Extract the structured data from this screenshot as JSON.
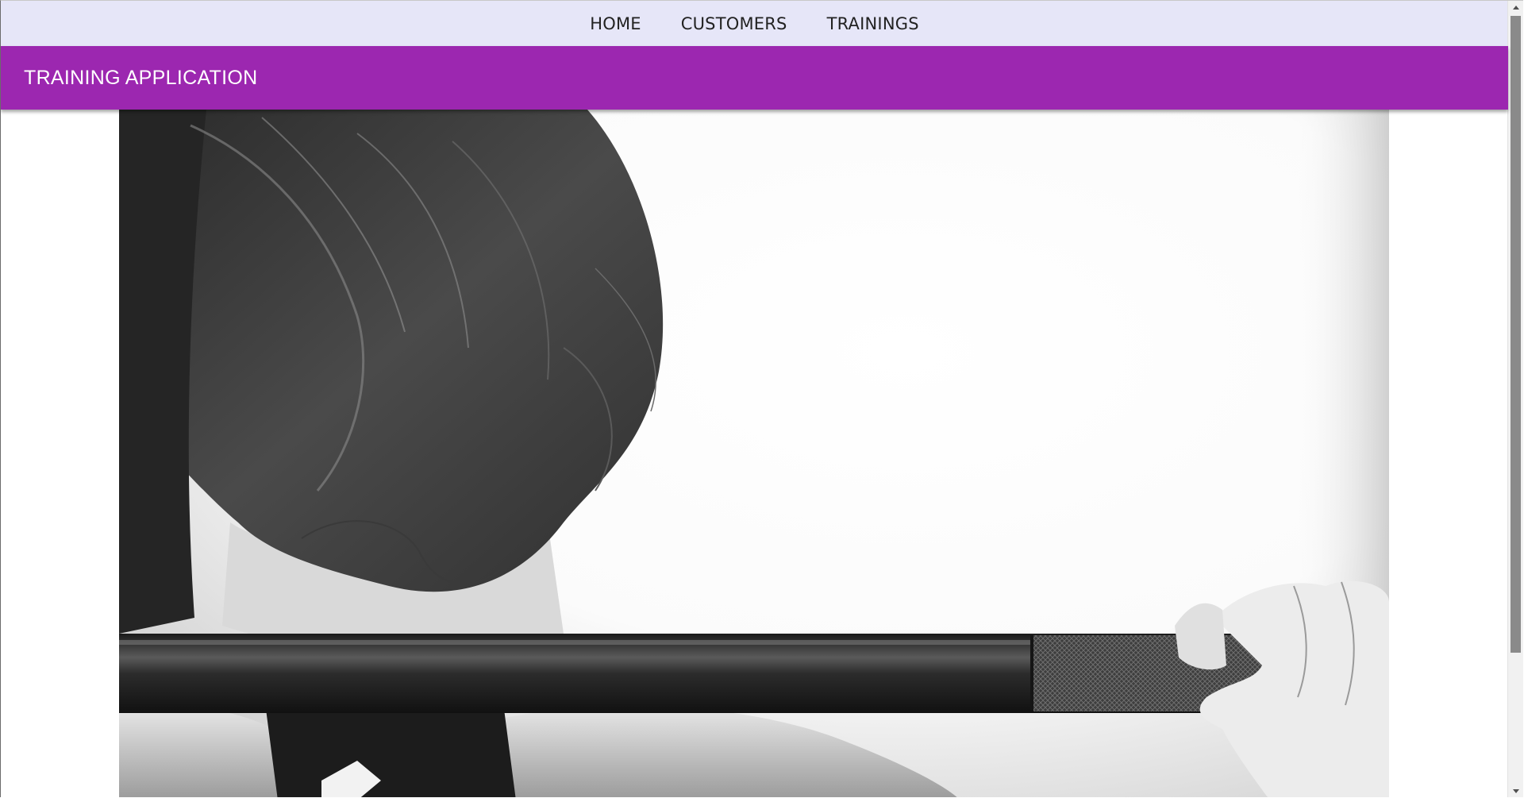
{
  "nav": {
    "items": [
      {
        "label": "HOME"
      },
      {
        "label": "CUSTOMERS"
      },
      {
        "label": "TRAININGS"
      }
    ]
  },
  "appbar": {
    "title": "TRAINING APPLICATION"
  },
  "colors": {
    "nav_background": "#e6e6f8",
    "appbar_background": "#9c27b0",
    "appbar_text": "#ffffff"
  },
  "scrollbar": {
    "scroll_position": 0
  }
}
